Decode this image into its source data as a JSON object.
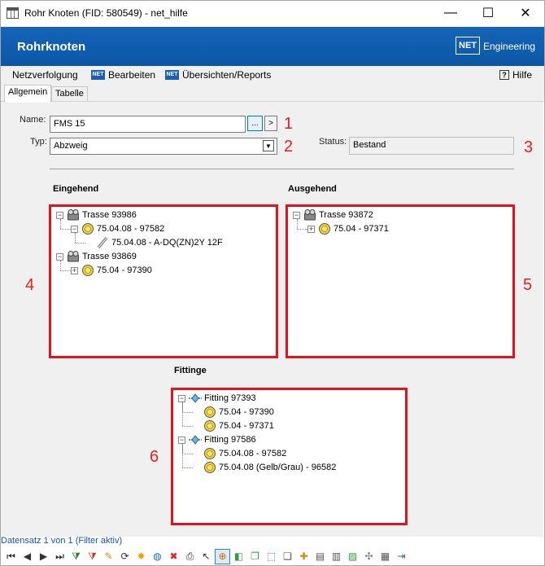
{
  "window": {
    "title": "Rohr Knoten (FID: 580549) - net_hilfe",
    "minimize": "—",
    "maximize": "☐",
    "close": "✕"
  },
  "header": {
    "title": "Rohrknoten",
    "logo_mark": "NET",
    "logo_text": "Engineering"
  },
  "menu": {
    "items": [
      {
        "label": "Netzverfolgung",
        "icon": ""
      },
      {
        "label": "Bearbeiten",
        "icon": "NET"
      },
      {
        "label": "Übersichten/Reports",
        "icon": "NET"
      }
    ],
    "help": {
      "label": "Hilfe",
      "icon": "?"
    }
  },
  "tabs": [
    {
      "label": "Allgemein",
      "active": true
    },
    {
      "label": "Tabelle",
      "active": false
    }
  ],
  "form": {
    "name_label": "Name:",
    "name_value": "FMS 15",
    "browse_label": "...",
    "goto_label": ">",
    "type_label": "Typ:",
    "type_value": "Abzweig",
    "type_arrow": "▼",
    "status_label": "Status:",
    "status_value": "Bestand"
  },
  "annotations": [
    "1",
    "2",
    "3",
    "4",
    "5",
    "6"
  ],
  "sections": {
    "incoming": {
      "title": "Eingehend",
      "nodes": [
        {
          "label": "Trasse 93986",
          "icon": "trasse-icon",
          "expander": "−",
          "level": 0
        },
        {
          "label": "75.04.08 - 97582",
          "icon": "circle-icon",
          "expander": "−",
          "level": 1
        },
        {
          "label": "75.04.08 - A-DQ(ZN)2Y 12F",
          "icon": "cable-icon",
          "expander": "",
          "level": 2
        },
        {
          "label": "Trasse 93869",
          "icon": "trasse-icon",
          "expander": "−",
          "level": 0
        },
        {
          "label": "75.04 - 97390",
          "icon": "circle-icon",
          "expander": "+",
          "level": 1
        }
      ]
    },
    "outgoing": {
      "title": "Ausgehend",
      "nodes": [
        {
          "label": "Trasse 93872",
          "icon": "trasse-icon",
          "expander": "−",
          "level": 0
        },
        {
          "label": "75.04 - 97371",
          "icon": "circle-icon",
          "expander": "+",
          "level": 1
        }
      ]
    },
    "fittings": {
      "title": "Fittinge",
      "nodes": [
        {
          "label": "Fitting 97393",
          "icon": "fitting-icon",
          "expander": "−",
          "level": 0
        },
        {
          "label": "75.04 - 97390",
          "icon": "circle-icon",
          "expander": "",
          "level": 1
        },
        {
          "label": "75.04 - 97371",
          "icon": "circle-icon",
          "expander": "",
          "level": 1
        },
        {
          "label": "Fitting 97586",
          "icon": "fitting-icon",
          "expander": "−",
          "level": 0
        },
        {
          "label": "75.04.08 - 97582",
          "icon": "circle-icon",
          "expander": "",
          "level": 1
        },
        {
          "label": "75.04.08 (Gelb/Grau) - 96582",
          "icon": "circle-icon",
          "expander": "",
          "level": 1
        }
      ]
    }
  },
  "record_status": "Datensatz 1 von 1 (Filter aktiv)",
  "toolbar": [
    {
      "name": "first-record-icon",
      "glyph": "⏮",
      "color": "#333333"
    },
    {
      "name": "previous-record-icon",
      "glyph": "◀",
      "color": "#333333"
    },
    {
      "name": "next-record-icon",
      "glyph": "▶",
      "color": "#333333"
    },
    {
      "name": "last-record-icon",
      "glyph": "⏭",
      "color": "#333333"
    },
    {
      "name": "filter-add-icon",
      "glyph": "⧩",
      "color": "#2a7a2a"
    },
    {
      "name": "filter-remove-icon",
      "glyph": "⧩",
      "color": "#c0392b"
    },
    {
      "name": "edit-pencil-icon",
      "glyph": "✎",
      "color": "#d08a00"
    },
    {
      "name": "refresh-icon",
      "glyph": "⟳",
      "color": "#333333"
    },
    {
      "name": "highlight-icon",
      "glyph": "✸",
      "color": "#f0a000"
    },
    {
      "name": "globe-icon",
      "glyph": "◍",
      "color": "#1f6fb3"
    },
    {
      "name": "delete-icon",
      "glyph": "✖",
      "color": "#e02020"
    },
    {
      "name": "print-icon",
      "glyph": "⎙",
      "color": "#333333"
    },
    {
      "name": "select-cursor-icon",
      "glyph": "↖",
      "color": "#333333"
    },
    {
      "name": "zoom-to-icon",
      "glyph": "⊕",
      "color": "#c07000"
    },
    {
      "name": "layer-green-icon",
      "glyph": "◧",
      "color": "#2e9a3e"
    },
    {
      "name": "layer-copy-icon",
      "glyph": "❐",
      "color": "#2e9a3e"
    },
    {
      "name": "selection-box-icon",
      "glyph": "⬚",
      "color": "#1f6fb3"
    },
    {
      "name": "duplicate-icon",
      "glyph": "❏",
      "color": "#555555"
    },
    {
      "name": "new-document-icon",
      "glyph": "✚",
      "color": "#d08a00"
    },
    {
      "name": "document-icon",
      "glyph": "▤",
      "color": "#555555"
    },
    {
      "name": "chart-document-icon",
      "glyph": "▥",
      "color": "#555555"
    },
    {
      "name": "image-add-icon",
      "glyph": "▨",
      "color": "#2e9a3e"
    },
    {
      "name": "network-icon",
      "glyph": "✣",
      "color": "#777777"
    },
    {
      "name": "table-icon",
      "glyph": "▦",
      "color": "#555555"
    },
    {
      "name": "export-icon",
      "glyph": "⇥",
      "color": "#1f6fb3"
    }
  ],
  "colors": {
    "header_blue": "#0c56a6",
    "highlight_red": "#e0141e",
    "status_blue": "#1a4fc4"
  }
}
